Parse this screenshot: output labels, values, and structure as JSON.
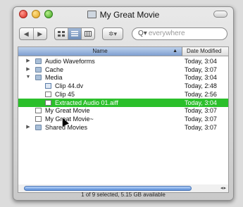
{
  "window": {
    "title": "My Great Movie"
  },
  "toolbar": {
    "nav": [
      "◀",
      "▶"
    ],
    "views": [
      "icon-view",
      "list-view",
      "column-view"
    ],
    "action_label": "✲▾",
    "search_placeholder": "everywhere"
  },
  "columns": {
    "name": "Name",
    "date": "Date Modified"
  },
  "rows": [
    {
      "name": "Audio Waveforms",
      "date": "Today, 3:04",
      "disclosure": "▶",
      "icon": "folder-icon",
      "indent": 0
    },
    {
      "name": "Cache",
      "date": "Today, 3:07",
      "disclosure": "▶",
      "icon": "folder-icon",
      "indent": 0
    },
    {
      "name": "Media",
      "date": "Today, 3:04",
      "disclosure": "▼",
      "icon": "folder-icon",
      "indent": 0
    },
    {
      "name": "Clip 44.dv",
      "date": "Today, 2:48",
      "disclosure": "",
      "icon": "dv-file-icon",
      "indent": 1
    },
    {
      "name": "Clip 45",
      "date": "Today, 2:56",
      "disclosure": "",
      "icon": "file-icon",
      "indent": 1
    },
    {
      "name": "Extracted Audio 01.aiff",
      "date": "Today, 3:04",
      "disclosure": "",
      "icon": "audio-file-icon",
      "indent": 1,
      "selected": true
    },
    {
      "name": "My Great Movie",
      "date": "Today, 3:07",
      "disclosure": "",
      "icon": "file-icon",
      "indent": 0
    },
    {
      "name": "My Great Movie~",
      "date": "Today, 3:07",
      "disclosure": "",
      "icon": "file-icon",
      "indent": 0
    },
    {
      "name": "Shared Movies",
      "date": "Today, 3:07",
      "disclosure": "▶",
      "icon": "folder-icon",
      "indent": 0
    }
  ],
  "status": "1 of 9 selected, 5.15 GB available",
  "colors": {
    "selection": "#2bbf2b",
    "header_sort": "#7f9fd0"
  }
}
